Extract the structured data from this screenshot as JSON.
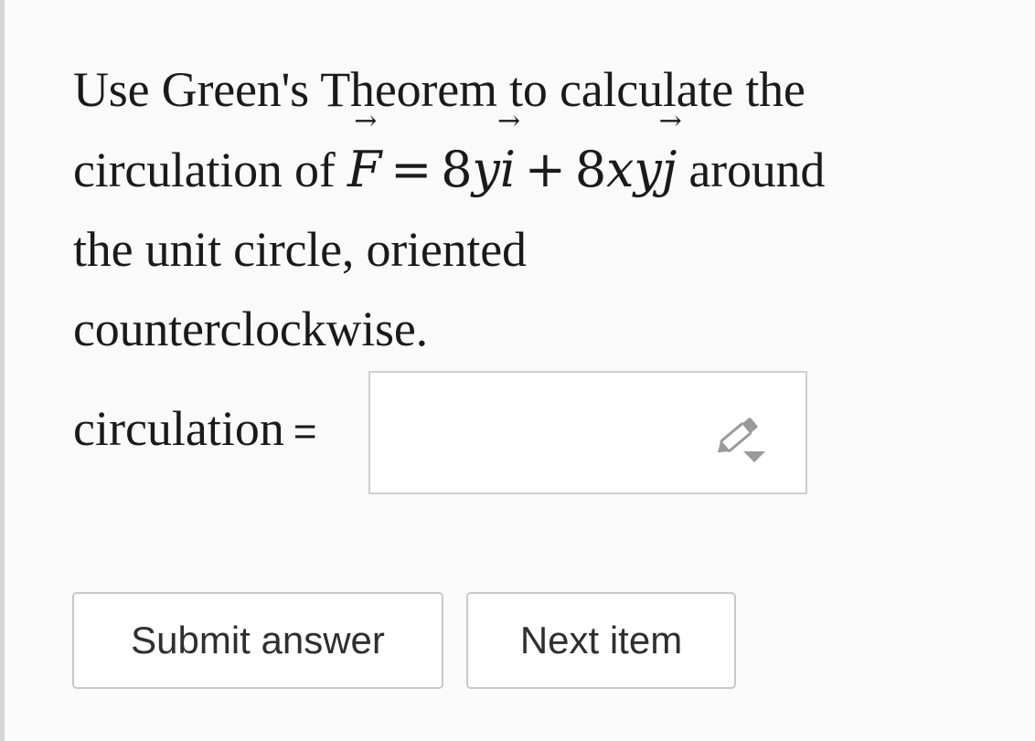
{
  "question": {
    "line1": "Use Green's Theorem to calculate the",
    "line2_prefix": "circulation of ",
    "math": {
      "F": "F",
      "equals": "=",
      "term1_coef": "8",
      "term1_var": "y",
      "i": "i",
      "plus": "+",
      "term2_coef": "8",
      "term2_var": "xy",
      "j": "j"
    },
    "line2_suffix": " around",
    "line3": "the unit circle, oriented",
    "line4": "counterclockwise."
  },
  "answer": {
    "label": "circulation",
    "equals": "=",
    "value": "",
    "icon": "pencil-icon"
  },
  "buttons": {
    "submit": "Submit answer",
    "next": "Next item"
  },
  "colors": {
    "background": "#fafafa",
    "border": "#c8c8c8",
    "icon": "#9a9a9a"
  }
}
